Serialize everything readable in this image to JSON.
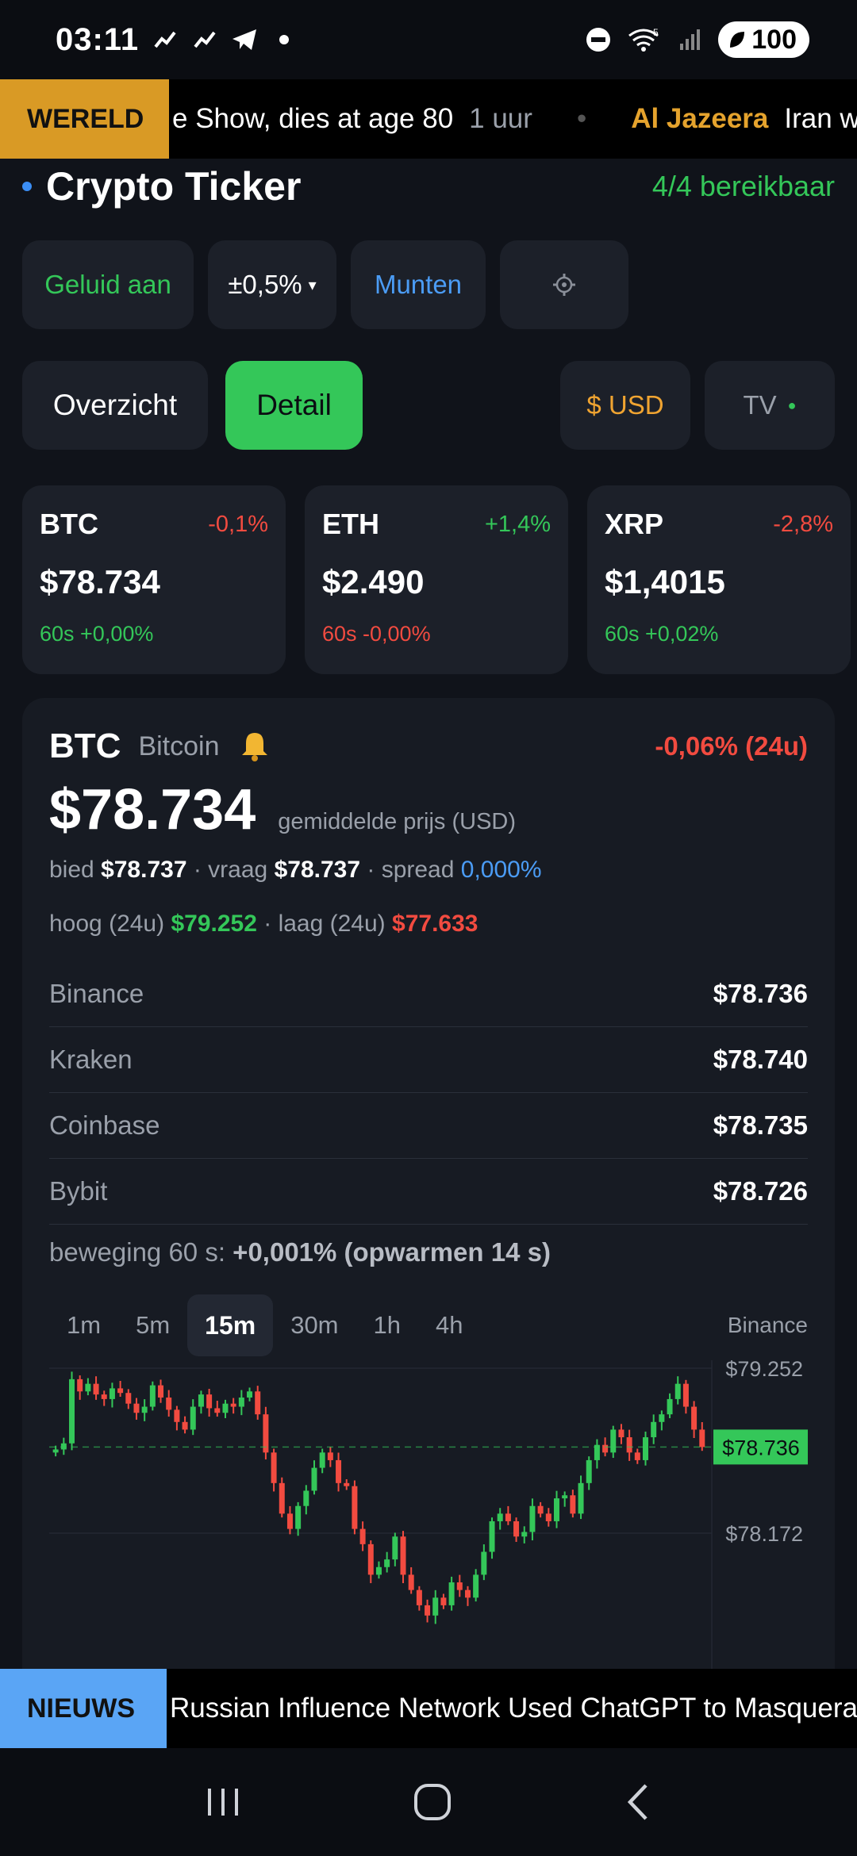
{
  "status_bar": {
    "time": "03:11",
    "battery": "100",
    "network": "5"
  },
  "world_ticker": {
    "tag": "WERELD",
    "text": "e Show, dies at age 80",
    "age": "1 uur",
    "separator": "•",
    "next_source": "Al Jazeera",
    "next_text": "Iran war"
  },
  "header": {
    "title": "Crypto Ticker",
    "status": "4/4 bereikbaar"
  },
  "controls": {
    "sound": "Geluid aan",
    "threshold": "±0,5%",
    "threshold_arrow": "▾",
    "coins": "Munten",
    "settings_icon": "gear-icon"
  },
  "view": {
    "overview": "Overzicht",
    "detail": "Detail",
    "currency": "$ USD",
    "tv": "TV",
    "tv_dot": "●"
  },
  "cards": [
    {
      "symbol": "BTC",
      "change": "-0,1%",
      "price": "$78.734",
      "m60": "60s +0,00%",
      "change_color": "#f24b40",
      "m60_color": "#34c759"
    },
    {
      "symbol": "ETH",
      "change": "+1,4%",
      "price": "$2.490",
      "m60": "60s -0,00%",
      "change_color": "#34c759",
      "m60_color": "#f24b40"
    },
    {
      "symbol": "XRP",
      "change": "-2,8%",
      "price": "$1,4015",
      "m60": "60s +0,02%",
      "change_color": "#f24b40",
      "m60_color": "#34c759"
    }
  ],
  "detail": {
    "symbol": "BTC",
    "name": "Bitcoin",
    "bell_icon": "bell-icon",
    "change": "-0,06% (24u)",
    "price": "$78.734",
    "price_caption": "gemiddelde prijs (USD)",
    "bid_label": "bied",
    "bid": "$78.737",
    "ask_label": "· vraag",
    "ask": "$78.737",
    "spread_label": "· spread",
    "spread": "0,000%",
    "high_label": "hoog (24u)",
    "high": "$79.252",
    "low_label": "· laag (24u)",
    "low": "$77.633",
    "exchanges": [
      {
        "name": "Binance",
        "price": "$78.736"
      },
      {
        "name": "Kraken",
        "price": "$78.740"
      },
      {
        "name": "Coinbase",
        "price": "$78.735"
      },
      {
        "name": "Bybit",
        "price": "$78.726"
      }
    ],
    "movement_label": "beweging 60 s:",
    "movement_value": "+0,001% (opwarmen 14 s)",
    "timeframes": [
      "1m",
      "5m",
      "15m",
      "30m",
      "1h",
      "4h"
    ],
    "active_timeframe": "15m",
    "chart_source": "Binance"
  },
  "chart_data": {
    "type": "candlestick",
    "y_ticks": [
      "$79.252",
      "$78.172"
    ],
    "current_label": "$78.736",
    "current_value": 78736,
    "y_top_value": 79252,
    "y_mid_value": 78172,
    "up_color": "#34c759",
    "down_color": "#f24b40",
    "closes": [
      78720,
      78760,
      79180,
      79100,
      79150,
      79080,
      79050,
      79120,
      79090,
      79020,
      78960,
      79000,
      79140,
      79060,
      78980,
      78900,
      78850,
      79000,
      79080,
      78990,
      78960,
      79020,
      79000,
      79060,
      79100,
      78950,
      78700,
      78500,
      78300,
      78200,
      78350,
      78450,
      78600,
      78700,
      78650,
      78500,
      78480,
      78200,
      78100,
      77900,
      77950,
      78000,
      78150,
      77900,
      77800,
      77700,
      77633,
      77750,
      77700,
      77850,
      77800,
      77750,
      77900,
      78050,
      78250,
      78300,
      78250,
      78150,
      78180,
      78350,
      78300,
      78250,
      78400,
      78420,
      78300,
      78500,
      78650,
      78750,
      78700,
      78850,
      78800,
      78700,
      78650,
      78800,
      78900,
      78950,
      79050,
      79150,
      79000,
      78850,
      78736
    ]
  },
  "news_ticker": {
    "tag": "NIEUWS",
    "text": "Russian Influence Network Used ChatGPT to Masquerade"
  },
  "navbar": {
    "recents_icon": "recents-icon",
    "home_icon": "home-icon",
    "back_icon": "back-icon"
  }
}
